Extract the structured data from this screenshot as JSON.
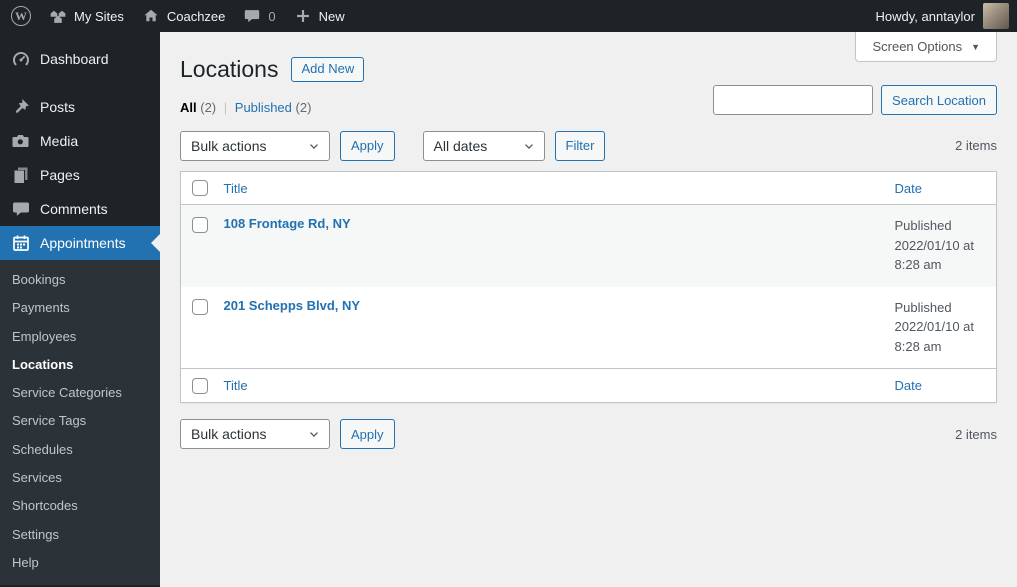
{
  "colors": {
    "accent": "#2271b1",
    "admin_bar_bg": "#1d2327",
    "menu_bg": "#1d2327",
    "submenu_bg": "#2c3338",
    "content_bg": "#f0f0f1",
    "row_stripe": "#f6f7f7",
    "border": "#c3c4c7"
  },
  "admin_bar": {
    "my_sites_label": "My Sites",
    "site_name": "Coachzee",
    "comments_count": "0",
    "new_label": "New",
    "howdy": "Howdy, anntaylor"
  },
  "sidebar": {
    "items": [
      {
        "label": "Dashboard",
        "icon": "dashboard-icon"
      },
      {
        "label": "Posts",
        "icon": "pushpin-icon"
      },
      {
        "label": "Media",
        "icon": "camera-icon"
      },
      {
        "label": "Pages",
        "icon": "pages-icon"
      },
      {
        "label": "Comments",
        "icon": "comment-icon"
      },
      {
        "label": "Appointments",
        "icon": "calendar-icon",
        "active": true
      }
    ],
    "submenu": [
      "Bookings",
      "Payments",
      "Employees",
      "Locations",
      "Service Categories",
      "Service Tags",
      "Schedules",
      "Services",
      "Shortcodes",
      "Settings",
      "Help"
    ],
    "current_submenu": "Locations"
  },
  "page": {
    "title": "Locations",
    "add_new_label": "Add New",
    "screen_options_label": "Screen Options",
    "views": {
      "all_label": "All",
      "all_count": "(2)",
      "separator": "|",
      "published_label": "Published",
      "published_count": "(2)"
    },
    "search_button_label": "Search Location",
    "bulk_actions_label": "Bulk actions",
    "apply_label": "Apply",
    "all_dates_label": "All dates",
    "filter_label": "Filter",
    "items_count": "2 items"
  },
  "table": {
    "columns": {
      "title": "Title",
      "date": "Date"
    },
    "rows": [
      {
        "title": "108 Frontage Rd, NY",
        "status": "Published",
        "datetime": "2022/01/10 at 8:28 am"
      },
      {
        "title": "201 Schepps Blvd, NY",
        "status": "Published",
        "datetime": "2022/01/10 at 8:28 am"
      }
    ]
  }
}
